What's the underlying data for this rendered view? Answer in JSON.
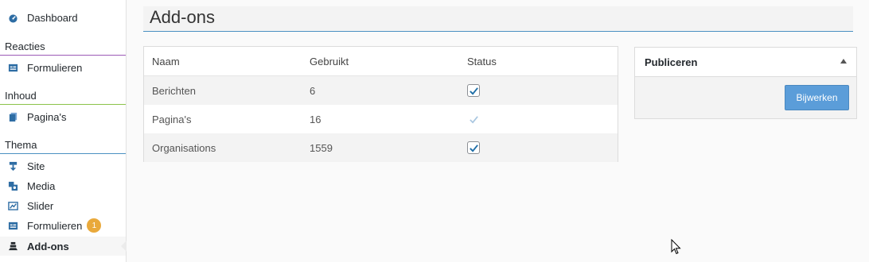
{
  "sidebar": {
    "dashboard": "Dashboard",
    "sections": {
      "reacties": "Reacties",
      "inhoud": "Inhoud",
      "thema": "Thema"
    },
    "items": {
      "formulieren_reacties": "Formulieren",
      "paginas": "Pagina's",
      "site": "Site",
      "media": "Media",
      "slider": "Slider",
      "formulieren_thema": "Formulieren",
      "addons": "Add-ons"
    },
    "formulieren_badge": "1"
  },
  "page": {
    "title": "Add-ons"
  },
  "table": {
    "headers": {
      "name": "Naam",
      "used": "Gebruikt",
      "status": "Status"
    },
    "rows": [
      {
        "name": "Berichten",
        "used": "6",
        "checked": true,
        "disabled": false
      },
      {
        "name": "Pagina's",
        "used": "16",
        "checked": true,
        "disabled": true
      },
      {
        "name": "Organisations",
        "used": "1559",
        "checked": true,
        "disabled": false
      }
    ]
  },
  "publish": {
    "title": "Publiceren",
    "button": "Bijwerken"
  },
  "colors": {
    "accent": "#4a90c2",
    "reacties_line": "#9b59b6",
    "inhoud_line": "#8bc34a",
    "badge": "#e9a93b",
    "button": "#5b9dd9",
    "check": "#1e6ea7"
  },
  "icons": {
    "dashboard": "dashboard-icon",
    "formulieren": "form-icon",
    "paginas": "pages-icon",
    "site": "site-icon",
    "media": "media-icon",
    "slider": "slider-icon",
    "addons": "addons-icon"
  }
}
